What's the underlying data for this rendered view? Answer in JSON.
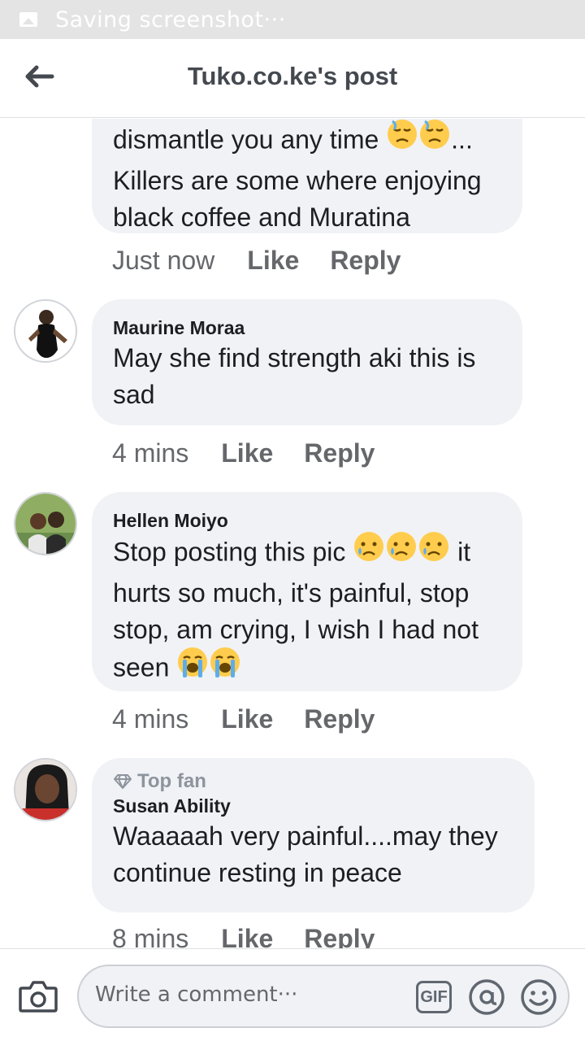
{
  "status_bar": {
    "text": "Saving screenshot···",
    "icon": "image-icon"
  },
  "header": {
    "title": "Tuko.co.ke's post",
    "back_icon": "back-arrow-icon"
  },
  "comments": [
    {
      "text_before": "dismantle you any time ",
      "emoji": [
        "sad-sweat-face",
        "sad-sweat-face"
      ],
      "text_after": "... Killers are some where enjoying black coffee and Muratina",
      "time": "Just now",
      "like": "Like",
      "reply": "Reply"
    },
    {
      "name": "Maurine Moraa",
      "text": "May she find strength aki this is sad",
      "time": "4 mins",
      "like": "Like",
      "reply": "Reply"
    },
    {
      "name": "Hellen Moiyo",
      "text_part1": "Stop posting this pic ",
      "emoji1": [
        "sad-tear-face",
        "sad-tear-face",
        "sad-tear-face"
      ],
      "text_part2": " it hurts so much, it's painful, stop stop, am crying, I wish I had not seen ",
      "emoji2": [
        "loudly-crying-face",
        "loudly-crying-face"
      ],
      "time": "4 mins",
      "like": "Like",
      "reply": "Reply"
    },
    {
      "badge": "Top fan",
      "badge_icon": "diamond-icon",
      "name": "Susan Ability",
      "text": "Waaaaah very painful....may they continue resting in peace",
      "time": "8 mins",
      "like": "Like",
      "reply": "Reply"
    }
  ],
  "composer": {
    "placeholder": "Write a comment···",
    "gif_label": "GIF",
    "camera_icon": "camera-icon",
    "mention_icon": "at-sign-icon",
    "emoji_icon": "smiley-icon"
  },
  "colors": {
    "bubble": "#f0f2f5",
    "muted": "#65676b",
    "header_title": "#444950",
    "status_bar": "#e4e4e4"
  }
}
